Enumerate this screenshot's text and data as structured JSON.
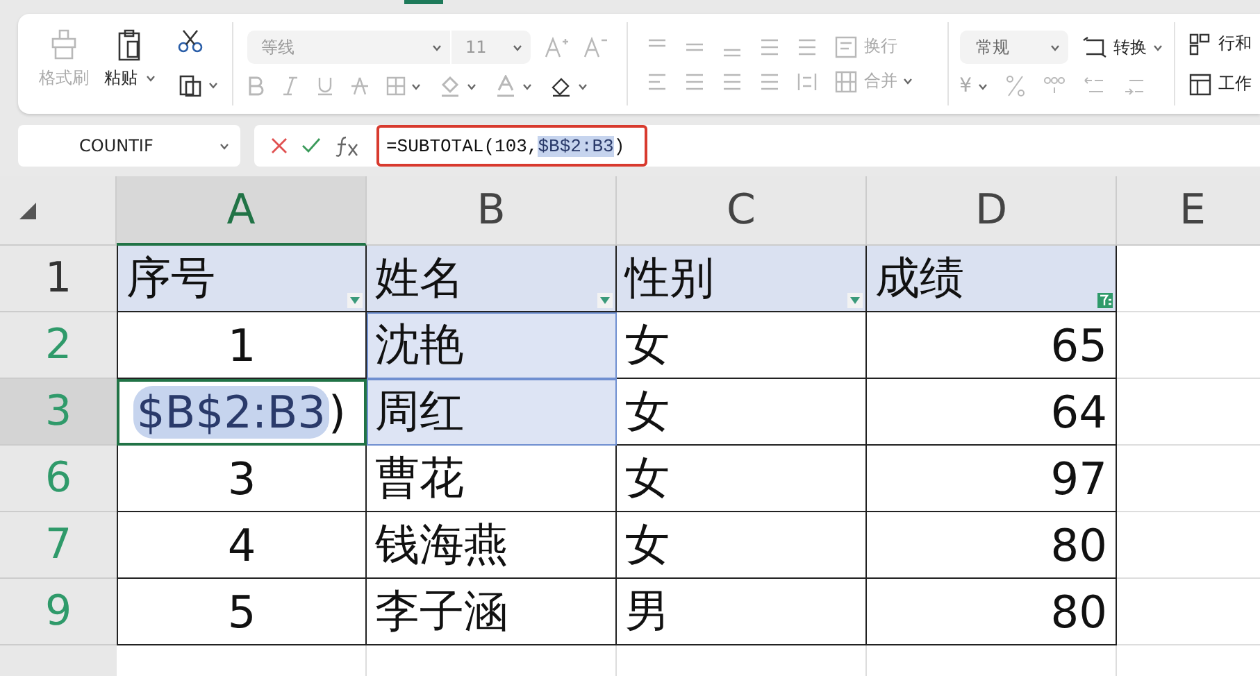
{
  "ribbon": {
    "clipboard": {
      "format_painter": {
        "label": "格式刷",
        "disabled": true
      },
      "paste": {
        "label": "粘贴",
        "disabled": false
      }
    },
    "font": {
      "name": "等线",
      "size": "11"
    },
    "alignment": {
      "wrap": "换行",
      "merge": "合并"
    },
    "number": {
      "format": "常规",
      "convert": "转换",
      "currency": "¥"
    },
    "cells": {
      "rows_cols": "行和",
      "worksheet": "工作"
    }
  },
  "formula_bar": {
    "name_box": "COUNTIF",
    "formula": {
      "prefix": "=SUBTOTAL(103,",
      "ref": "$B$2:B3",
      "suffix": ")"
    }
  },
  "grid": {
    "columns": [
      {
        "label": "A",
        "selected": true
      },
      {
        "label": "B",
        "selected": false
      },
      {
        "label": "C",
        "selected": false
      },
      {
        "label": "D",
        "selected": false
      },
      {
        "label": "E",
        "selected": false
      }
    ],
    "rows": [
      {
        "header": "1",
        "filtered": false,
        "selected": false,
        "cells": [
          {
            "kind": "header",
            "text": "序号",
            "selected": false,
            "filter_active": false
          },
          {
            "kind": "header",
            "text": "姓名",
            "selected": false,
            "filter_active": false
          },
          {
            "kind": "header",
            "text": "性别",
            "selected": false,
            "filter_active": false
          },
          {
            "kind": "header",
            "text": "成绩",
            "selected": false,
            "filter_active": true
          }
        ]
      },
      {
        "header": "2",
        "filtered": true,
        "selected": false,
        "cells": [
          {
            "kind": "value",
            "text": "1",
            "selected": false
          },
          {
            "kind": "value",
            "text": "沈艳",
            "selected": true
          },
          {
            "kind": "value",
            "text": "女",
            "selected": false
          },
          {
            "kind": "value",
            "text": "65",
            "selected": false
          }
        ]
      },
      {
        "header": "3",
        "filtered": true,
        "selected": true,
        "cells": [
          {
            "kind": "edit",
            "ref": "$B$2:B3",
            "suffix": ")",
            "selected": false
          },
          {
            "kind": "value",
            "text": "周红",
            "selected": true
          },
          {
            "kind": "value",
            "text": "女",
            "selected": false
          },
          {
            "kind": "value",
            "text": "64",
            "selected": false
          }
        ]
      },
      {
        "header": "6",
        "filtered": true,
        "selected": false,
        "cells": [
          {
            "kind": "value",
            "text": "3",
            "selected": false
          },
          {
            "kind": "value",
            "text": "曹花",
            "selected": false
          },
          {
            "kind": "value",
            "text": "女",
            "selected": false
          },
          {
            "kind": "value",
            "text": "97",
            "selected": false
          }
        ]
      },
      {
        "header": "7",
        "filtered": true,
        "selected": false,
        "cells": [
          {
            "kind": "value",
            "text": "4",
            "selected": false
          },
          {
            "kind": "value",
            "text": "钱海燕",
            "selected": false
          },
          {
            "kind": "value",
            "text": "女",
            "selected": false
          },
          {
            "kind": "value",
            "text": "80",
            "selected": false
          }
        ]
      },
      {
        "header": "9",
        "filtered": true,
        "selected": false,
        "cells": [
          {
            "kind": "value",
            "text": "5",
            "selected": false
          },
          {
            "kind": "value",
            "text": "李子涵",
            "selected": false
          },
          {
            "kind": "value",
            "text": "男",
            "selected": false
          },
          {
            "kind": "value",
            "text": "80",
            "selected": false
          }
        ]
      }
    ]
  }
}
